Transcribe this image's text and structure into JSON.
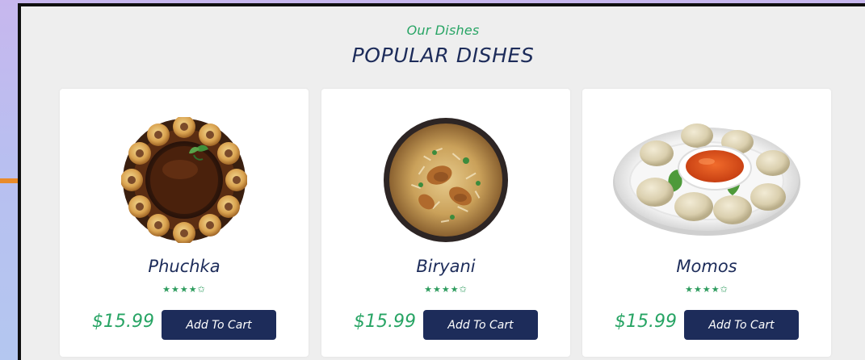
{
  "section": {
    "subtitle": "Our Dishes",
    "title": "POPULAR DISHES"
  },
  "dishes": [
    {
      "name": "Phuchka",
      "rating_stars": "★★★★✩",
      "price": "$15.99",
      "button_label": "Add To Cart",
      "image_icon": "phuchka-dish-image"
    },
    {
      "name": "Biryani",
      "rating_stars": "★★★★✩",
      "price": "$15.99",
      "button_label": "Add To Cart",
      "image_icon": "biryani-dish-image"
    },
    {
      "name": "Momos",
      "rating_stars": "★★★★✩",
      "price": "$15.99",
      "button_label": "Add To Cart",
      "image_icon": "momos-dish-image"
    }
  ],
  "colors": {
    "accent_green": "#27a464",
    "navy": "#1d2c5a",
    "card_bg": "#ffffff",
    "section_bg": "#eeeeee",
    "arrow_orange": "#e98b2a"
  }
}
